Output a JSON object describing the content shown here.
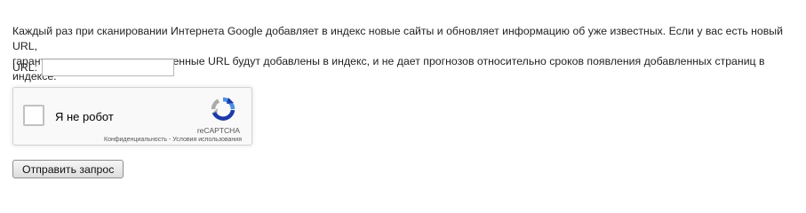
{
  "intro": {
    "line1": "Каждый раз при сканировании Интернета Google добавляет в индекс новые сайты и обновляет информацию об уже известных. Если у вас есть новый URL,",
    "line2": "гарантировать, что все отправленные URL будут добавлены в индекс, и не дает прогнозов относительно сроков появления добавленных страниц в индексе."
  },
  "form": {
    "url_label": "URL:",
    "url_value": "",
    "submit_label": "Отправить запрос"
  },
  "recaptcha": {
    "label": "Я не робот",
    "checked": false,
    "brand": "reCAPTCHA",
    "privacy": "Конфиденциальность",
    "separator": " - ",
    "terms": "Условия использования",
    "logo_colors": {
      "blue": "#1c3aa9",
      "light_blue": "#4a90e2",
      "gray": "#ababab"
    }
  }
}
